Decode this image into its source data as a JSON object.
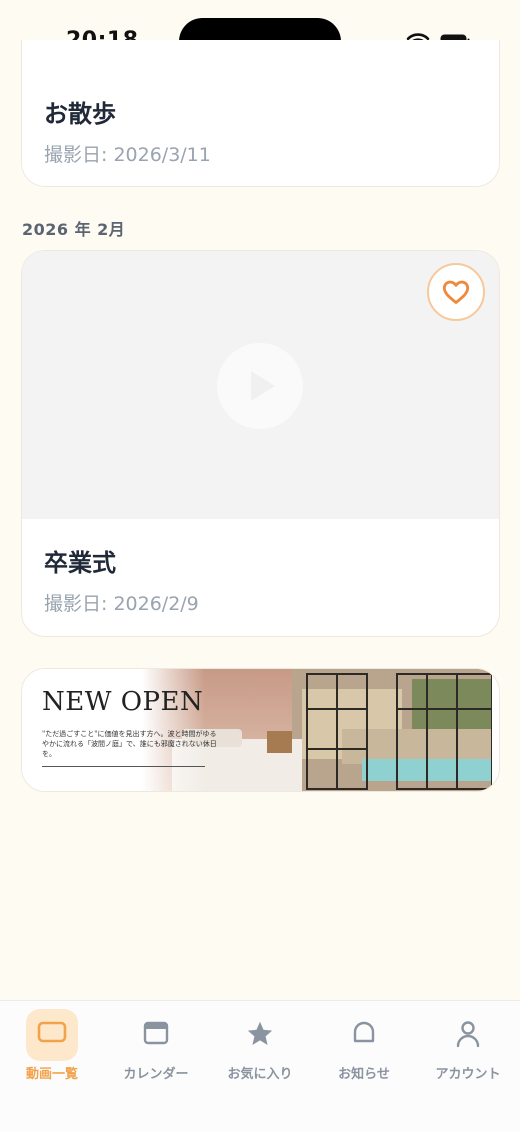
{
  "status_bar": {
    "time": "20:18"
  },
  "videos": [
    {
      "title": "お散歩",
      "date": "撮影日: 2026/3/11"
    }
  ],
  "section": {
    "header": "2026 年 2月"
  },
  "feb_videos": [
    {
      "title": "卒業式",
      "date": "撮影日: 2026/2/9"
    }
  ],
  "banner": {
    "title": "NEW OPEN",
    "body": "\"ただ過ごすこと\"に価値を見出す方へ。波と時間がゆるやかに流れる「波間ノ庭」で、誰にも邪魔されない休日を。"
  },
  "tabs": [
    {
      "label": "動画一覧",
      "icon": "video-list-icon",
      "active": true
    },
    {
      "label": "カレンダー",
      "icon": "calendar-icon",
      "active": false
    },
    {
      "label": "お気に入り",
      "icon": "star-icon",
      "active": false
    },
    {
      "label": "お知らせ",
      "icon": "bell-icon",
      "active": false
    },
    {
      "label": "アカウント",
      "icon": "person-icon",
      "active": false
    }
  ],
  "colors": {
    "accent": "#f2a24b",
    "background": "#fefbf2",
    "inactive": "#8a93a0"
  }
}
